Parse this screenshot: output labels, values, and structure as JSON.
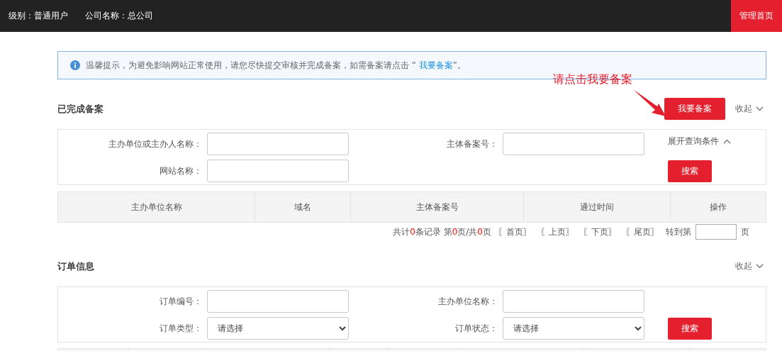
{
  "top_bar": {
    "items": [
      {
        "label": "级别：",
        "value": "普通用户"
      },
      {
        "label": "公司名称：",
        "value": "总公司"
      }
    ],
    "nav": [
      {
        "label": "管理首页",
        "selected": true
      }
    ]
  },
  "notice": {
    "before": "温馨提示，为避免影响网站正常使用，请您尽快提交审核并完成备案，如需备案请点击 “ ",
    "link": "我要备案",
    "after": "”。"
  },
  "annotation": {
    "text": "请点击我要备案"
  },
  "sections": [
    {
      "title": "已完成备案",
      "action": "我要备案",
      "collapse": "收起",
      "form": {
        "fields": [
          {
            "label": "主办单位或主办人名称：",
            "kind": "input"
          },
          {
            "label": "主体备案号：",
            "kind": "input"
          },
          {
            "label": "网站名称：",
            "kind": "input"
          }
        ],
        "expand": "展开查询条件",
        "search": "搜索"
      },
      "table": {
        "columns": [
          "主办单位名称",
          "域名",
          "主体备案号",
          "通过时间",
          "操作"
        ]
      },
      "pager": {
        "parts": [
          {
            "text": "共计",
            "kind": "plain"
          },
          {
            "text": "0",
            "kind": "count"
          },
          {
            "text": "条记录 第",
            "kind": "plain"
          },
          {
            "text": "0",
            "kind": "count"
          },
          {
            "text": "页/共",
            "kind": "plain"
          },
          {
            "text": "0",
            "kind": "count"
          },
          {
            "text": "页",
            "kind": "plain"
          }
        ],
        "links": [
          "〖首页〗",
          "〖上页〗",
          "〖下页〗",
          "〖尾页〗"
        ],
        "goto": "转到第",
        "unit": "页"
      }
    },
    {
      "title": "订单信息",
      "collapse": "收起",
      "form": {
        "fields": [
          {
            "label": "订单编号：",
            "kind": "input"
          },
          {
            "label": "主办单位名称：",
            "kind": "input"
          },
          {
            "label": "订单类型：",
            "kind": "select",
            "value": "请选择"
          },
          {
            "label": "订单状态：",
            "kind": "select",
            "value": "请选择"
          }
        ],
        "search": "搜索"
      },
      "table": {
        "columns": [
          "",
          "",
          "",
          "",
          "",
          "",
          "",
          ""
        ]
      }
    }
  ]
}
